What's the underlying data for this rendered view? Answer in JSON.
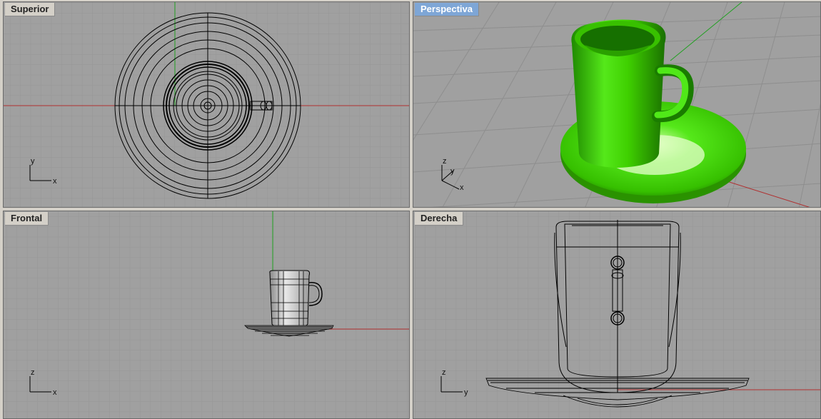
{
  "viewports": {
    "top": {
      "title": "Superior",
      "axis_h": "x",
      "axis_v": "y"
    },
    "perspective": {
      "title": "Perspectiva",
      "axis_h": "x",
      "axis_v": "y",
      "axis_z": "z"
    },
    "front": {
      "title": "Frontal",
      "axis_h": "x",
      "axis_v": "z"
    },
    "right": {
      "title": "Derecha",
      "axis_h": "y",
      "axis_v": "z"
    }
  },
  "colors": {
    "viewport_bg": "#a0a0a0",
    "grid_minor": "#969696",
    "grid_major": "#8a8a8a",
    "axis_x": "#b03030",
    "axis_y": "#20a020",
    "active_title_bg": "#7ea6d6",
    "model_green": "#3ed000",
    "wire": "#000000"
  }
}
